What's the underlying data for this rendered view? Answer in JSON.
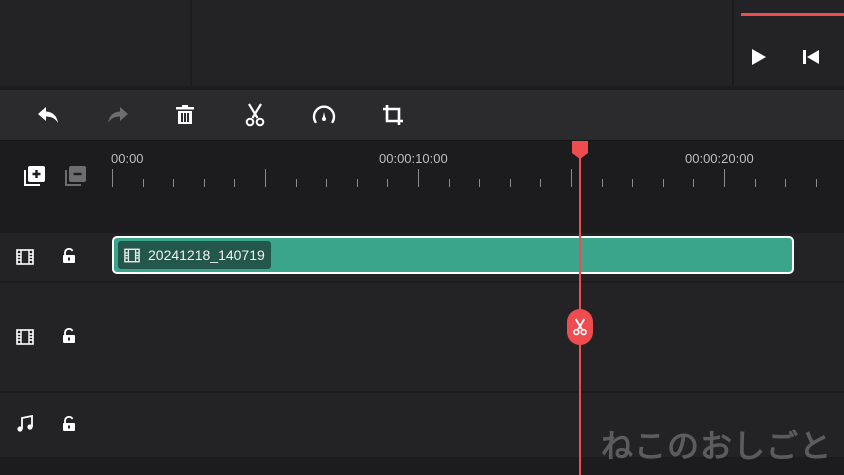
{
  "preview": {
    "play_icon": "play-icon",
    "start_icon": "skip-to-start-icon"
  },
  "toolbar": {
    "buttons": [
      {
        "name": "undo",
        "icon": "undo-icon"
      },
      {
        "name": "redo",
        "icon": "redo-icon"
      },
      {
        "name": "delete",
        "icon": "trash-icon"
      },
      {
        "name": "split",
        "icon": "scissors-icon"
      },
      {
        "name": "speed",
        "icon": "speedometer-icon"
      },
      {
        "name": "crop",
        "icon": "crop-icon"
      }
    ]
  },
  "track_controls": {
    "add_track_icon": "add-track-icon",
    "remove_track_icon": "remove-track-icon"
  },
  "ruler": {
    "labels": [
      "00:00",
      "00:00:10:00",
      "00:00:20:00"
    ]
  },
  "tracks": [
    {
      "type": "video",
      "icon": "film-icon",
      "lock_icon": "unlock-icon"
    },
    {
      "type": "video",
      "icon": "film-icon",
      "lock_icon": "unlock-icon"
    },
    {
      "type": "audio",
      "icon": "music-note-icon",
      "lock_icon": "unlock-icon"
    }
  ],
  "clip": {
    "name": "20241218_140719",
    "color": "#3ba58c"
  },
  "playhead": {
    "color": "#ef4c4f",
    "split_icon": "scissors-icon"
  },
  "watermark": "ねこのおしごと"
}
